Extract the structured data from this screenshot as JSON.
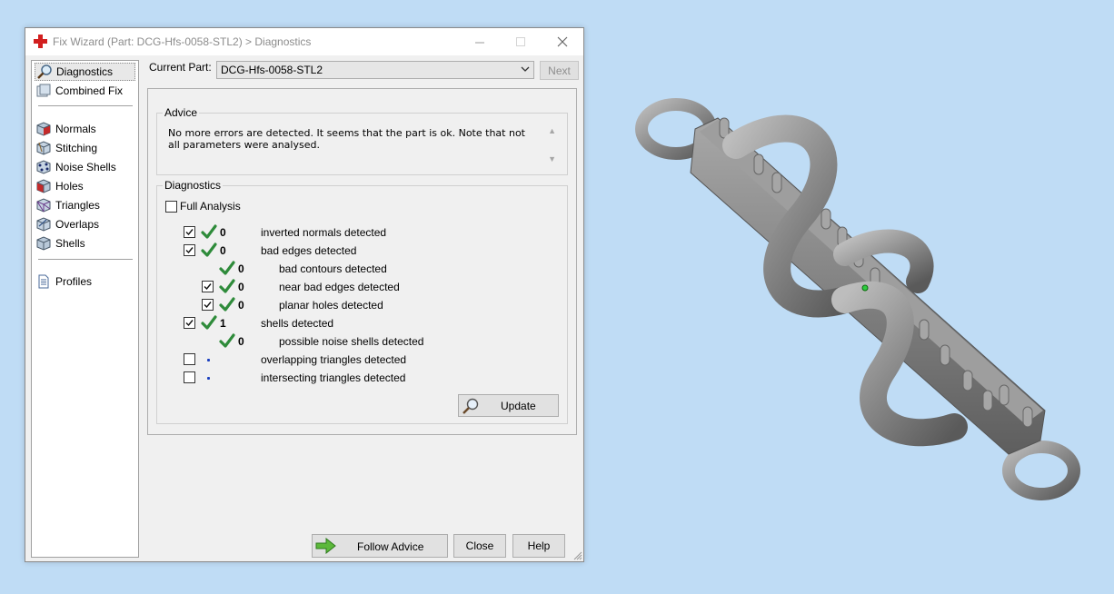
{
  "window": {
    "title": "Fix Wizard (Part: DCG-Hfs-0058-STL2) > Diagnostics"
  },
  "nav": {
    "items": [
      {
        "label": "Diagnostics",
        "icon": "magnifier-icon",
        "selected": true
      },
      {
        "label": "Combined Fix",
        "icon": "combined-fix-icon"
      },
      {
        "label": "Normals",
        "icon": "normals-cube-icon"
      },
      {
        "label": "Stitching",
        "icon": "stitching-cube-icon"
      },
      {
        "label": "Noise Shells",
        "icon": "noise-shells-icon"
      },
      {
        "label": "Holes",
        "icon": "holes-cube-icon"
      },
      {
        "label": "Triangles",
        "icon": "triangles-cube-icon"
      },
      {
        "label": "Overlaps",
        "icon": "overlaps-cube-icon"
      },
      {
        "label": "Shells",
        "icon": "shells-cube-icon"
      },
      {
        "label": "Profiles",
        "icon": "profiles-document-icon"
      }
    ]
  },
  "part": {
    "label": "Current Part:",
    "value": "DCG-Hfs-0058-STL2",
    "next_label": "Next"
  },
  "advice": {
    "title": "Advice",
    "text": "No more errors are detected. It seems that the part is ok. Note that not all parameters were analysed."
  },
  "diagnostics": {
    "title": "Diagnostics",
    "full_analysis_label": "Full Analysis",
    "full_analysis_checked": false,
    "rows": [
      {
        "checked": true,
        "status": "ok",
        "count": "0",
        "label": "inverted normals detected"
      },
      {
        "checked": true,
        "status": "ok",
        "count": "0",
        "label": "bad edges detected"
      },
      {
        "checked": null,
        "status": "ok",
        "count": "0",
        "label": "bad contours detected"
      },
      {
        "checked": true,
        "status": "ok",
        "count": "0",
        "label": "near bad edges detected"
      },
      {
        "checked": true,
        "status": "ok",
        "count": "0",
        "label": "planar holes detected"
      },
      {
        "checked": true,
        "status": "ok",
        "count": "1",
        "label": "shells detected"
      },
      {
        "checked": null,
        "status": "ok",
        "count": "0",
        "label": "possible noise shells detected"
      },
      {
        "checked": false,
        "status": "none",
        "count": "",
        "label": "overlapping triangles detected"
      },
      {
        "checked": false,
        "status": "none",
        "count": "",
        "label": "intersecting triangles detected"
      }
    ],
    "update_label": "Update"
  },
  "buttons": {
    "follow_advice": "Follow Advice",
    "close": "Close",
    "help": "Help"
  },
  "colors": {
    "background": "#bfdcf5",
    "check_green": "#2e8b3a",
    "dot_blue": "#1a3fbf",
    "model_grey": "#8c8c8c"
  }
}
